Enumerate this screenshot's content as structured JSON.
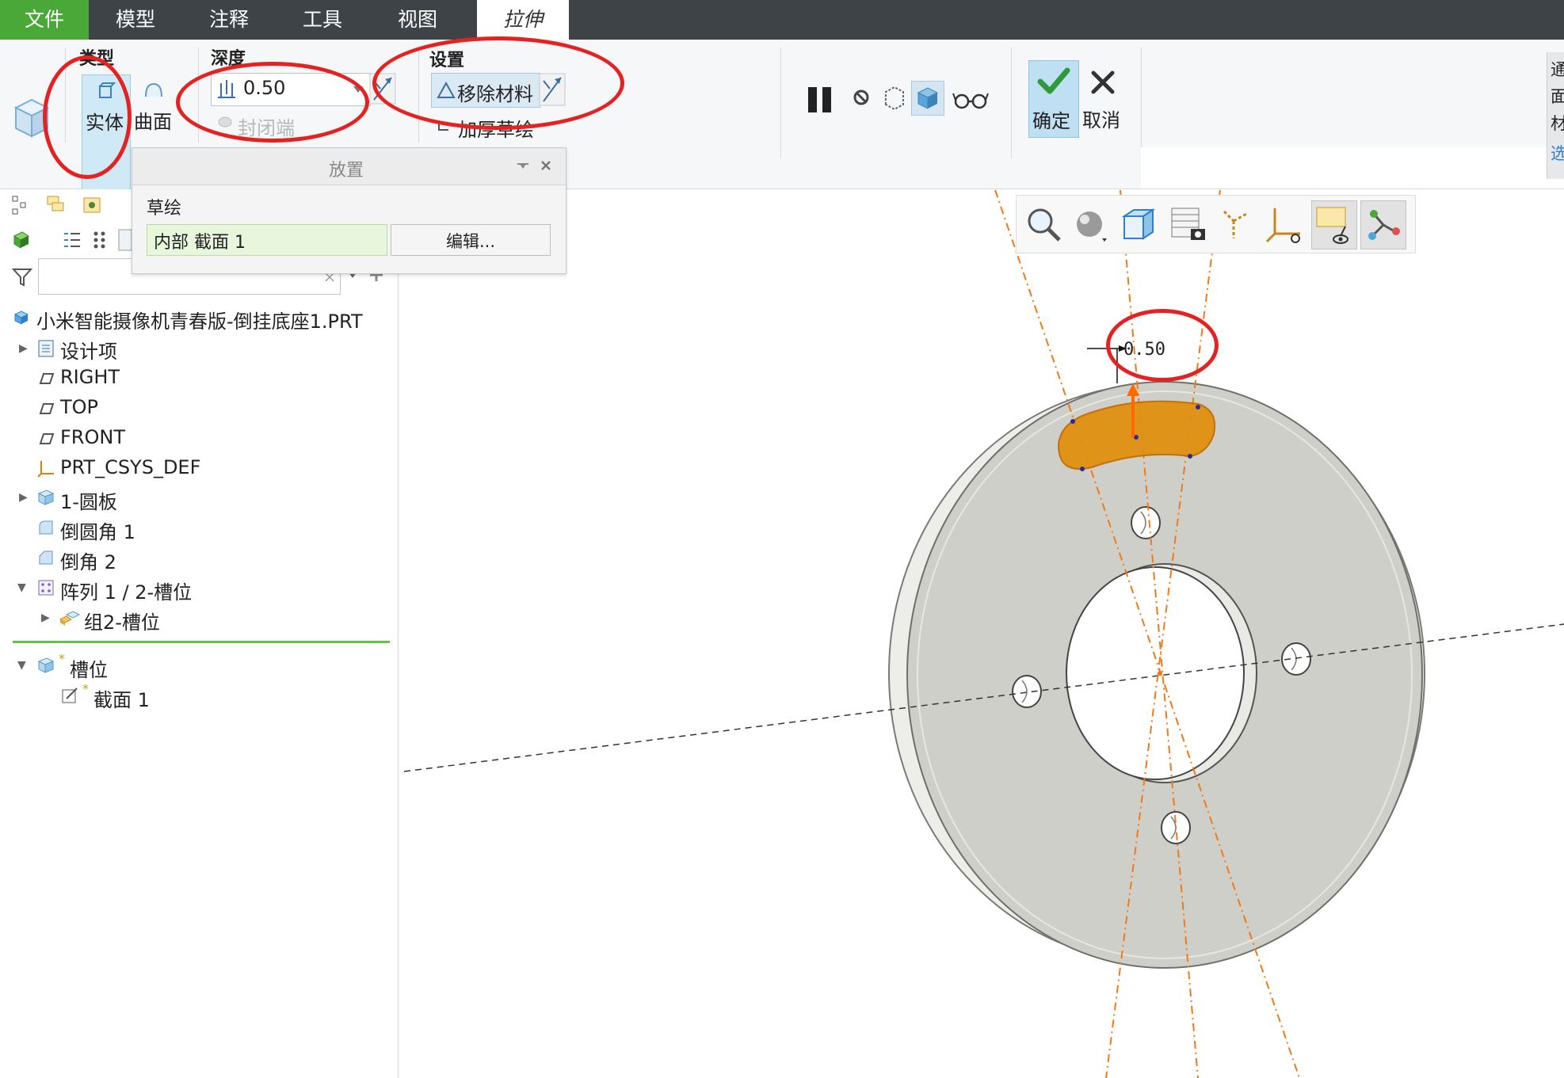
{
  "menu": {
    "file": "文件",
    "model": "模型",
    "annotate": "注释",
    "tools": "工具",
    "view": "视图",
    "active_tab": "拉伸"
  },
  "ribbon": {
    "type_title": "类型",
    "solid": "实体",
    "surface": "曲面",
    "depth_title": "深度",
    "depth_value": "0.50",
    "capped_ends": "封闭端",
    "settings_title": "设置",
    "remove_material": "移除材料",
    "thicken_sketch": "加厚草绘",
    "ok": "确定",
    "cancel": "取消",
    "right_partial": [
      "通",
      "面",
      "材",
      "选"
    ]
  },
  "placement_panel": {
    "title": "放置",
    "sketch_label": "草绘",
    "section_value": "内部 截面 1",
    "edit_button": "编辑..."
  },
  "model_tree": {
    "root": "小米智能摄像机青春版-倒挂底座1.PRT",
    "items": [
      {
        "label": "设计项"
      },
      {
        "label": "RIGHT"
      },
      {
        "label": "TOP"
      },
      {
        "label": "FRONT"
      },
      {
        "label": "PRT_CSYS_DEF"
      },
      {
        "label": "1-圆板"
      },
      {
        "label": "倒圆角 1"
      },
      {
        "label": "倒角 2"
      },
      {
        "label": "阵列 1 / 2-槽位"
      },
      {
        "label": "组2-槽位"
      },
      {
        "label": "槽位"
      },
      {
        "label": "截面 1"
      }
    ]
  },
  "viewport": {
    "dimension_label": "0.50",
    "colors": {
      "part_face": "#cfcfca",
      "selection_orange": "#e09010",
      "axis_orange": "#ef7a18",
      "annotation_red": "#e42222",
      "accent_green": "#4aa838"
    }
  }
}
